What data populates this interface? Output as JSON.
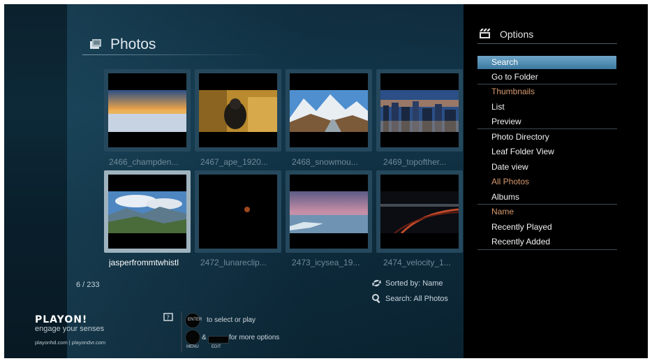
{
  "header": {
    "title": "Photos"
  },
  "photos": [
    {
      "caption": "2466_champden...",
      "selected": false
    },
    {
      "caption": "2467_ape_1920...",
      "selected": false
    },
    {
      "caption": "2468_snowmou...",
      "selected": false
    },
    {
      "caption": "2469_topofther...",
      "selected": false
    },
    {
      "caption": "jasperfrommtwhistl",
      "selected": true
    },
    {
      "caption": "2472_lunareclip...",
      "selected": false
    },
    {
      "caption": "2473_icysea_19...",
      "selected": false
    },
    {
      "caption": "2474_velocity_1...",
      "selected": false
    }
  ],
  "status": {
    "count": "6 / 233",
    "sorted_by": "Sorted by: Name",
    "search": "Search: All Photos"
  },
  "brand": {
    "logo_text": "PLAYON!",
    "tagline": "engage your senses",
    "urls": "playonhd.com | playondvr.com"
  },
  "help": {
    "enter_key": "ENTER",
    "select_text": "to select or play",
    "ampersand": "&",
    "more_text": "for more options",
    "menu_label": "MENU",
    "edit_label": "EDIT"
  },
  "options": {
    "title": "Options",
    "items": [
      {
        "label": "Search",
        "selected": true
      },
      {
        "label": "Go to Folder"
      },
      {
        "label": "Thumbnails",
        "active": true
      },
      {
        "label": "List"
      },
      {
        "label": "Preview"
      },
      {
        "label": "Photo Directory"
      },
      {
        "label": "Leaf Folder View"
      },
      {
        "label": "Date view"
      },
      {
        "label": "All Photos",
        "active": true
      },
      {
        "label": "Albums"
      },
      {
        "label": "Name",
        "active": true
      },
      {
        "label": "Recently Played"
      },
      {
        "label": "Recently Added"
      }
    ]
  },
  "colors": {
    "active_option": "#d79a6e",
    "selection_highlight": "#4d8ab2",
    "logo_accent": "#f28c28"
  }
}
